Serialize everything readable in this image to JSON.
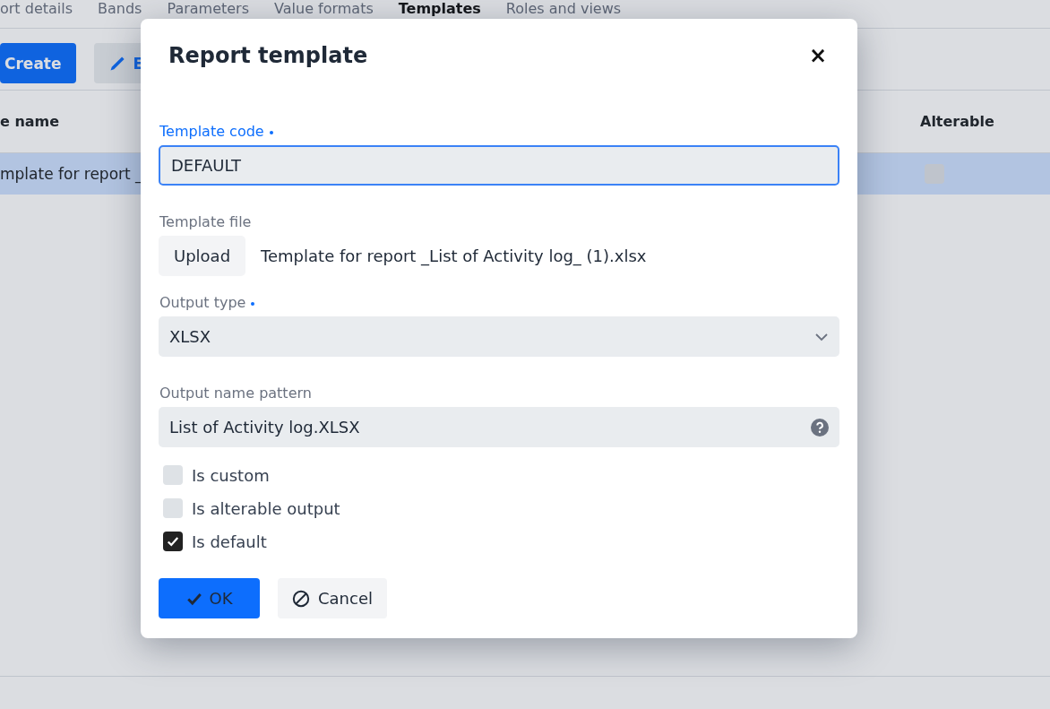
{
  "tabs": [
    {
      "label": "ort details",
      "selected": false
    },
    {
      "label": "Bands",
      "selected": false
    },
    {
      "label": "Parameters",
      "selected": false
    },
    {
      "label": "Value formats",
      "selected": false
    },
    {
      "label": "Templates",
      "selected": true
    },
    {
      "label": "Roles and views",
      "selected": false
    }
  ],
  "toolbar": {
    "create": "Create",
    "edit": "E"
  },
  "table": {
    "columns": [
      "e name",
      "Alterable"
    ],
    "rows": [
      {
        "name": "mplate for report _",
        "alterable": false,
        "selected": true
      }
    ]
  },
  "dialog": {
    "title": "Report template",
    "close": "×",
    "template_code": {
      "label": "Template code",
      "required": true,
      "value": "DEFAULT",
      "focused": true
    },
    "template_file": {
      "label": "Template file",
      "button": "Upload",
      "file_name": "Template for report _List of Activity log_ (1).xlsx"
    },
    "output_type": {
      "label": "Output type",
      "required": true,
      "value": "XLSX"
    },
    "output_name_pattern": {
      "label": "Output name pattern",
      "value": "List of Activity log.XLSX"
    },
    "checkboxes": [
      {
        "label": "Is custom",
        "checked": false
      },
      {
        "label": "Is alterable output",
        "checked": false
      },
      {
        "label": "Is default",
        "checked": true
      }
    ],
    "ok": "OK",
    "cancel": "Cancel"
  }
}
